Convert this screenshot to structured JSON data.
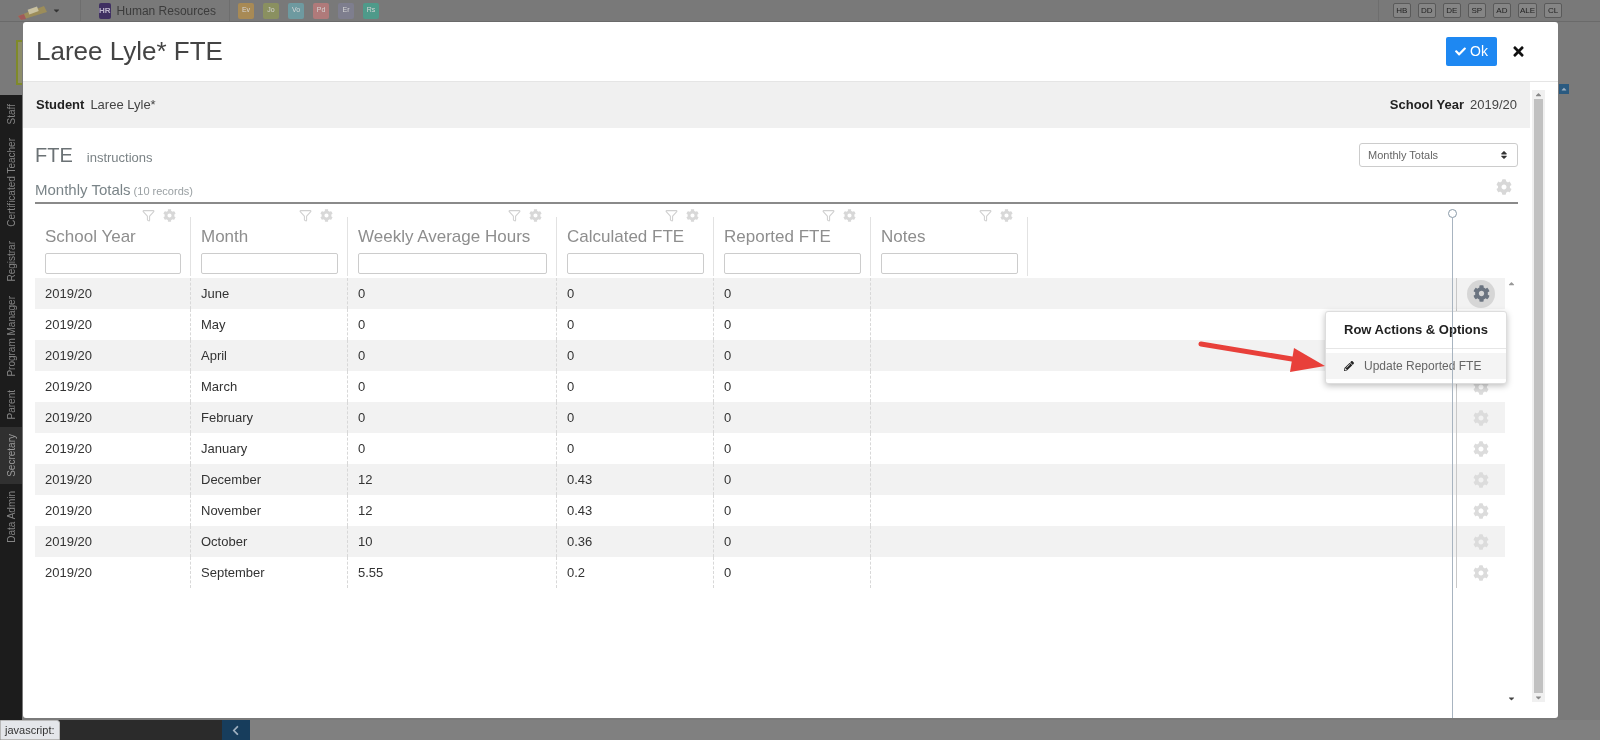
{
  "top_bar": {
    "module_badge": "HR",
    "module": "Human Resources",
    "apps": [
      {
        "label": "Ev",
        "color": "#a88a55"
      },
      {
        "label": "Jo",
        "color": "#8a9060"
      },
      {
        "label": "Vo",
        "color": "#6e9aa0"
      },
      {
        "label": "Pd",
        "color": "#b07a7a"
      },
      {
        "label": "Er",
        "color": "#7e7e8e"
      },
      {
        "label": "Rs",
        "color": "#4f9a8a"
      }
    ],
    "right_apps": [
      "HB",
      "DD",
      "DE",
      "SP",
      "AD",
      "ALE",
      "CL"
    ]
  },
  "sidebar": [
    {
      "label": "Staff",
      "selected": false
    },
    {
      "label": "Certificated Teacher",
      "selected": false
    },
    {
      "label": "Registrar",
      "selected": false
    },
    {
      "label": "Program Manager",
      "selected": false
    },
    {
      "label": "Parent",
      "selected": false
    },
    {
      "label": "Secretary",
      "selected": true
    },
    {
      "label": "Data Admin",
      "selected": false
    }
  ],
  "modal": {
    "title": "Laree Lyle* FTE",
    "ok_button": "Ok",
    "student_label": "Student",
    "student": "Laree Lyle*",
    "year_label": "School Year",
    "year": "2019/20",
    "section_title": "FTE",
    "instructions_link": "instructions",
    "view_select": "Monthly Totals",
    "table_title": "Monthly Totals",
    "record_count": "(10 records)",
    "columns": [
      "School Year",
      "Month",
      "Weekly Average Hours",
      "Calculated FTE",
      "Reported FTE",
      "Notes"
    ],
    "rows": [
      {
        "cells": [
          "2019/20",
          "June",
          "0",
          "0",
          "0"
        ],
        "menu_open": true
      },
      {
        "cells": [
          "2019/20",
          "May",
          "0",
          "0",
          "0"
        ],
        "menu_open": false
      },
      {
        "cells": [
          "2019/20",
          "April",
          "0",
          "0",
          "0"
        ],
        "menu_open": false
      },
      {
        "cells": [
          "2019/20",
          "March",
          "0",
          "0",
          "0"
        ],
        "menu_open": false
      },
      {
        "cells": [
          "2019/20",
          "February",
          "0",
          "0",
          "0"
        ],
        "menu_open": false
      },
      {
        "cells": [
          "2019/20",
          "January",
          "0",
          "0",
          "0"
        ],
        "menu_open": false
      },
      {
        "cells": [
          "2019/20",
          "December",
          "12",
          "0.43",
          "0"
        ],
        "menu_open": false
      },
      {
        "cells": [
          "2019/20",
          "November",
          "12",
          "0.43",
          "0"
        ],
        "menu_open": false
      },
      {
        "cells": [
          "2019/20",
          "October",
          "10",
          "0.36",
          "0"
        ],
        "menu_open": false
      },
      {
        "cells": [
          "2019/20",
          "September",
          "5.55",
          "0.2",
          "0"
        ],
        "menu_open": false
      }
    ],
    "row_menu": {
      "title": "Row Actions & Options",
      "items": [
        "Update Reported FTE"
      ]
    }
  },
  "status_tooltip": "javascript:"
}
